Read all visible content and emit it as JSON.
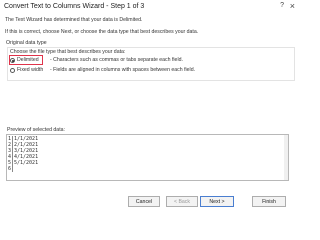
{
  "dialog": {
    "title": "Convert Text to Columns Wizard - Step 1 of 3",
    "help": "?",
    "close": "×",
    "intro1": "The Text Wizard has determined that your data is Delimited.",
    "intro2": "If this is correct, choose Next, or choose the data type that best describes your data."
  },
  "original": {
    "legend": "Original data type",
    "prompt": "Choose the file type that best describes your data:",
    "options": [
      {
        "label": "Delimited",
        "desc": "- Characters such as commas or tabs separate each field.",
        "selected": true
      },
      {
        "label": "Fixed width",
        "desc": "- Fields are aligned in columns with spaces between each field.",
        "selected": false
      }
    ]
  },
  "preview": {
    "label": "Preview of selected data:",
    "rows": [
      {
        "num": "1",
        "text": "1/1/2021"
      },
      {
        "num": "2",
        "text": "2/1/2021"
      },
      {
        "num": "3",
        "text": "3/1/2021"
      },
      {
        "num": "4",
        "text": "4/1/2021"
      },
      {
        "num": "5",
        "text": "5/1/2021"
      },
      {
        "num": "6",
        "text": ""
      }
    ]
  },
  "buttons": {
    "cancel": "Cancel",
    "back": "< Back",
    "next": "Next >",
    "finish": "Finish"
  }
}
